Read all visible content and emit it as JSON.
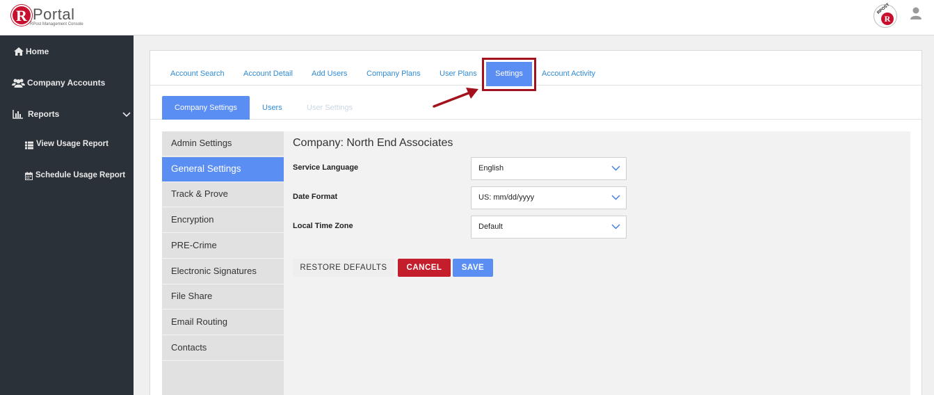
{
  "header": {
    "logo_letter": "R",
    "logo_text": "Portal",
    "logo_subtitle": "RPost Management Console",
    "badge_ring_text": "RPOST",
    "badge_letter": "R"
  },
  "sidebar": {
    "items": [
      {
        "label": "Home",
        "icon": "home-icon"
      },
      {
        "label": "Company Accounts",
        "icon": "users-icon"
      },
      {
        "label": "Reports",
        "icon": "bar-chart-icon"
      },
      {
        "label": "View Usage Report",
        "icon": "list-icon"
      },
      {
        "label": "Schedule Usage Report",
        "icon": "calendar-icon"
      }
    ]
  },
  "tabs": {
    "items": [
      "Account Search",
      "Account Detail",
      "Add Users",
      "Company Plans",
      "User Plans"
    ],
    "active": "Settings",
    "after": "Account Activity"
  },
  "subtabs": {
    "active": "Company Settings",
    "users": "Users",
    "user_settings": "User Settings"
  },
  "settings_menu": {
    "items": [
      "Admin Settings",
      "General Settings",
      "Track & Prove",
      "Encryption",
      "PRE-Crime",
      "Electronic Signatures",
      "File Share",
      "Email Routing",
      "Contacts"
    ],
    "active_index": 1
  },
  "general": {
    "company_title": "Company: North End Associates",
    "fields": [
      {
        "label": "Service Language",
        "value": "English"
      },
      {
        "label": "Date Format",
        "value": "US: mm/dd/yyyy"
      },
      {
        "label": "Local Time Zone",
        "value": "Default"
      }
    ],
    "buttons": {
      "restore": "RESTORE DEFAULTS",
      "cancel": "CANCEL",
      "save": "SAVE"
    }
  },
  "colors": {
    "accent": "#5b8ef2",
    "link": "#2f8bd6",
    "brand_red": "#c8102e",
    "highlight": "#a3111d",
    "sidebar_bg": "#2b3138"
  }
}
